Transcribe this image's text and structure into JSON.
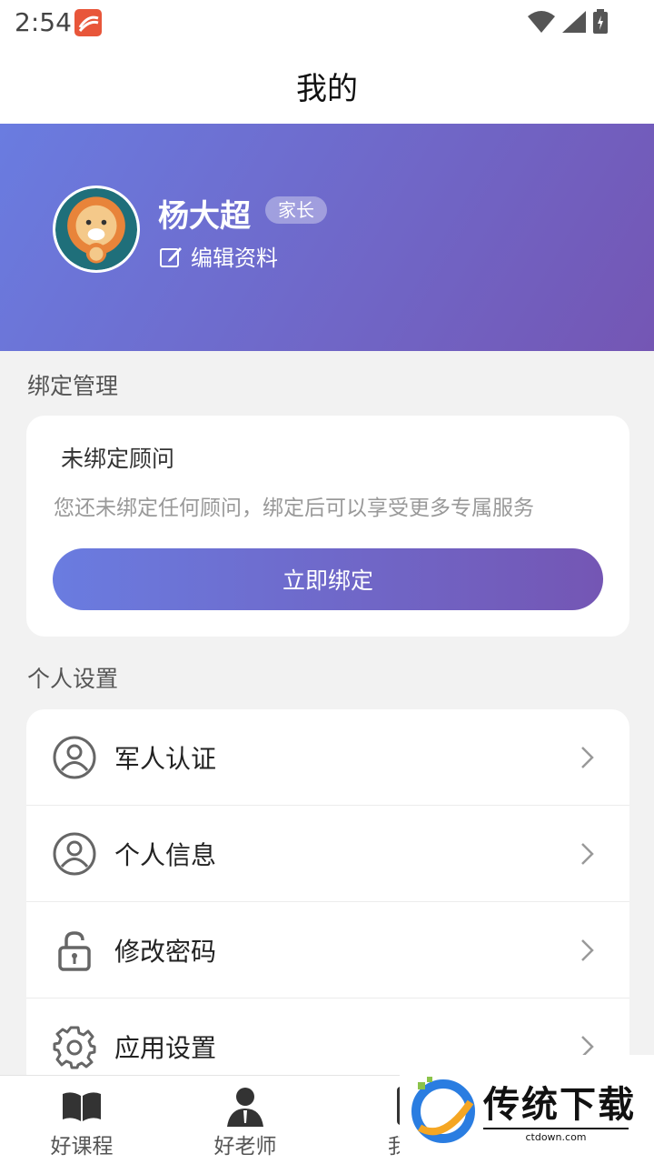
{
  "status_bar": {
    "time": "2:54"
  },
  "header": {
    "title": "我的"
  },
  "profile": {
    "name": "杨大超",
    "role": "家长",
    "edit_label": "编辑资料"
  },
  "binding": {
    "section_title": "绑定管理",
    "title": "未绑定顾问",
    "description": "您还未绑定任何顾问，绑定后可以享受更多专属服务",
    "button_label": "立即绑定"
  },
  "settings": {
    "section_title": "个人设置",
    "items": [
      {
        "label": "军人认证",
        "icon": "user-circle-icon"
      },
      {
        "label": "个人信息",
        "icon": "user-circle-icon"
      },
      {
        "label": "修改密码",
        "icon": "lock-icon"
      },
      {
        "label": "应用设置",
        "icon": "gear-icon"
      }
    ]
  },
  "bottom_nav": {
    "items": [
      {
        "label": "好课程",
        "icon": "book-icon"
      },
      {
        "label": "好老师",
        "icon": "teacher-icon"
      },
      {
        "label": "我的",
        "icon": "phone-icon"
      }
    ]
  },
  "watermark": {
    "text": "传统下载",
    "sub": "ctdown.com"
  },
  "colors": {
    "gradient_start": "#6a7ce0",
    "gradient_end": "#7456b4"
  }
}
